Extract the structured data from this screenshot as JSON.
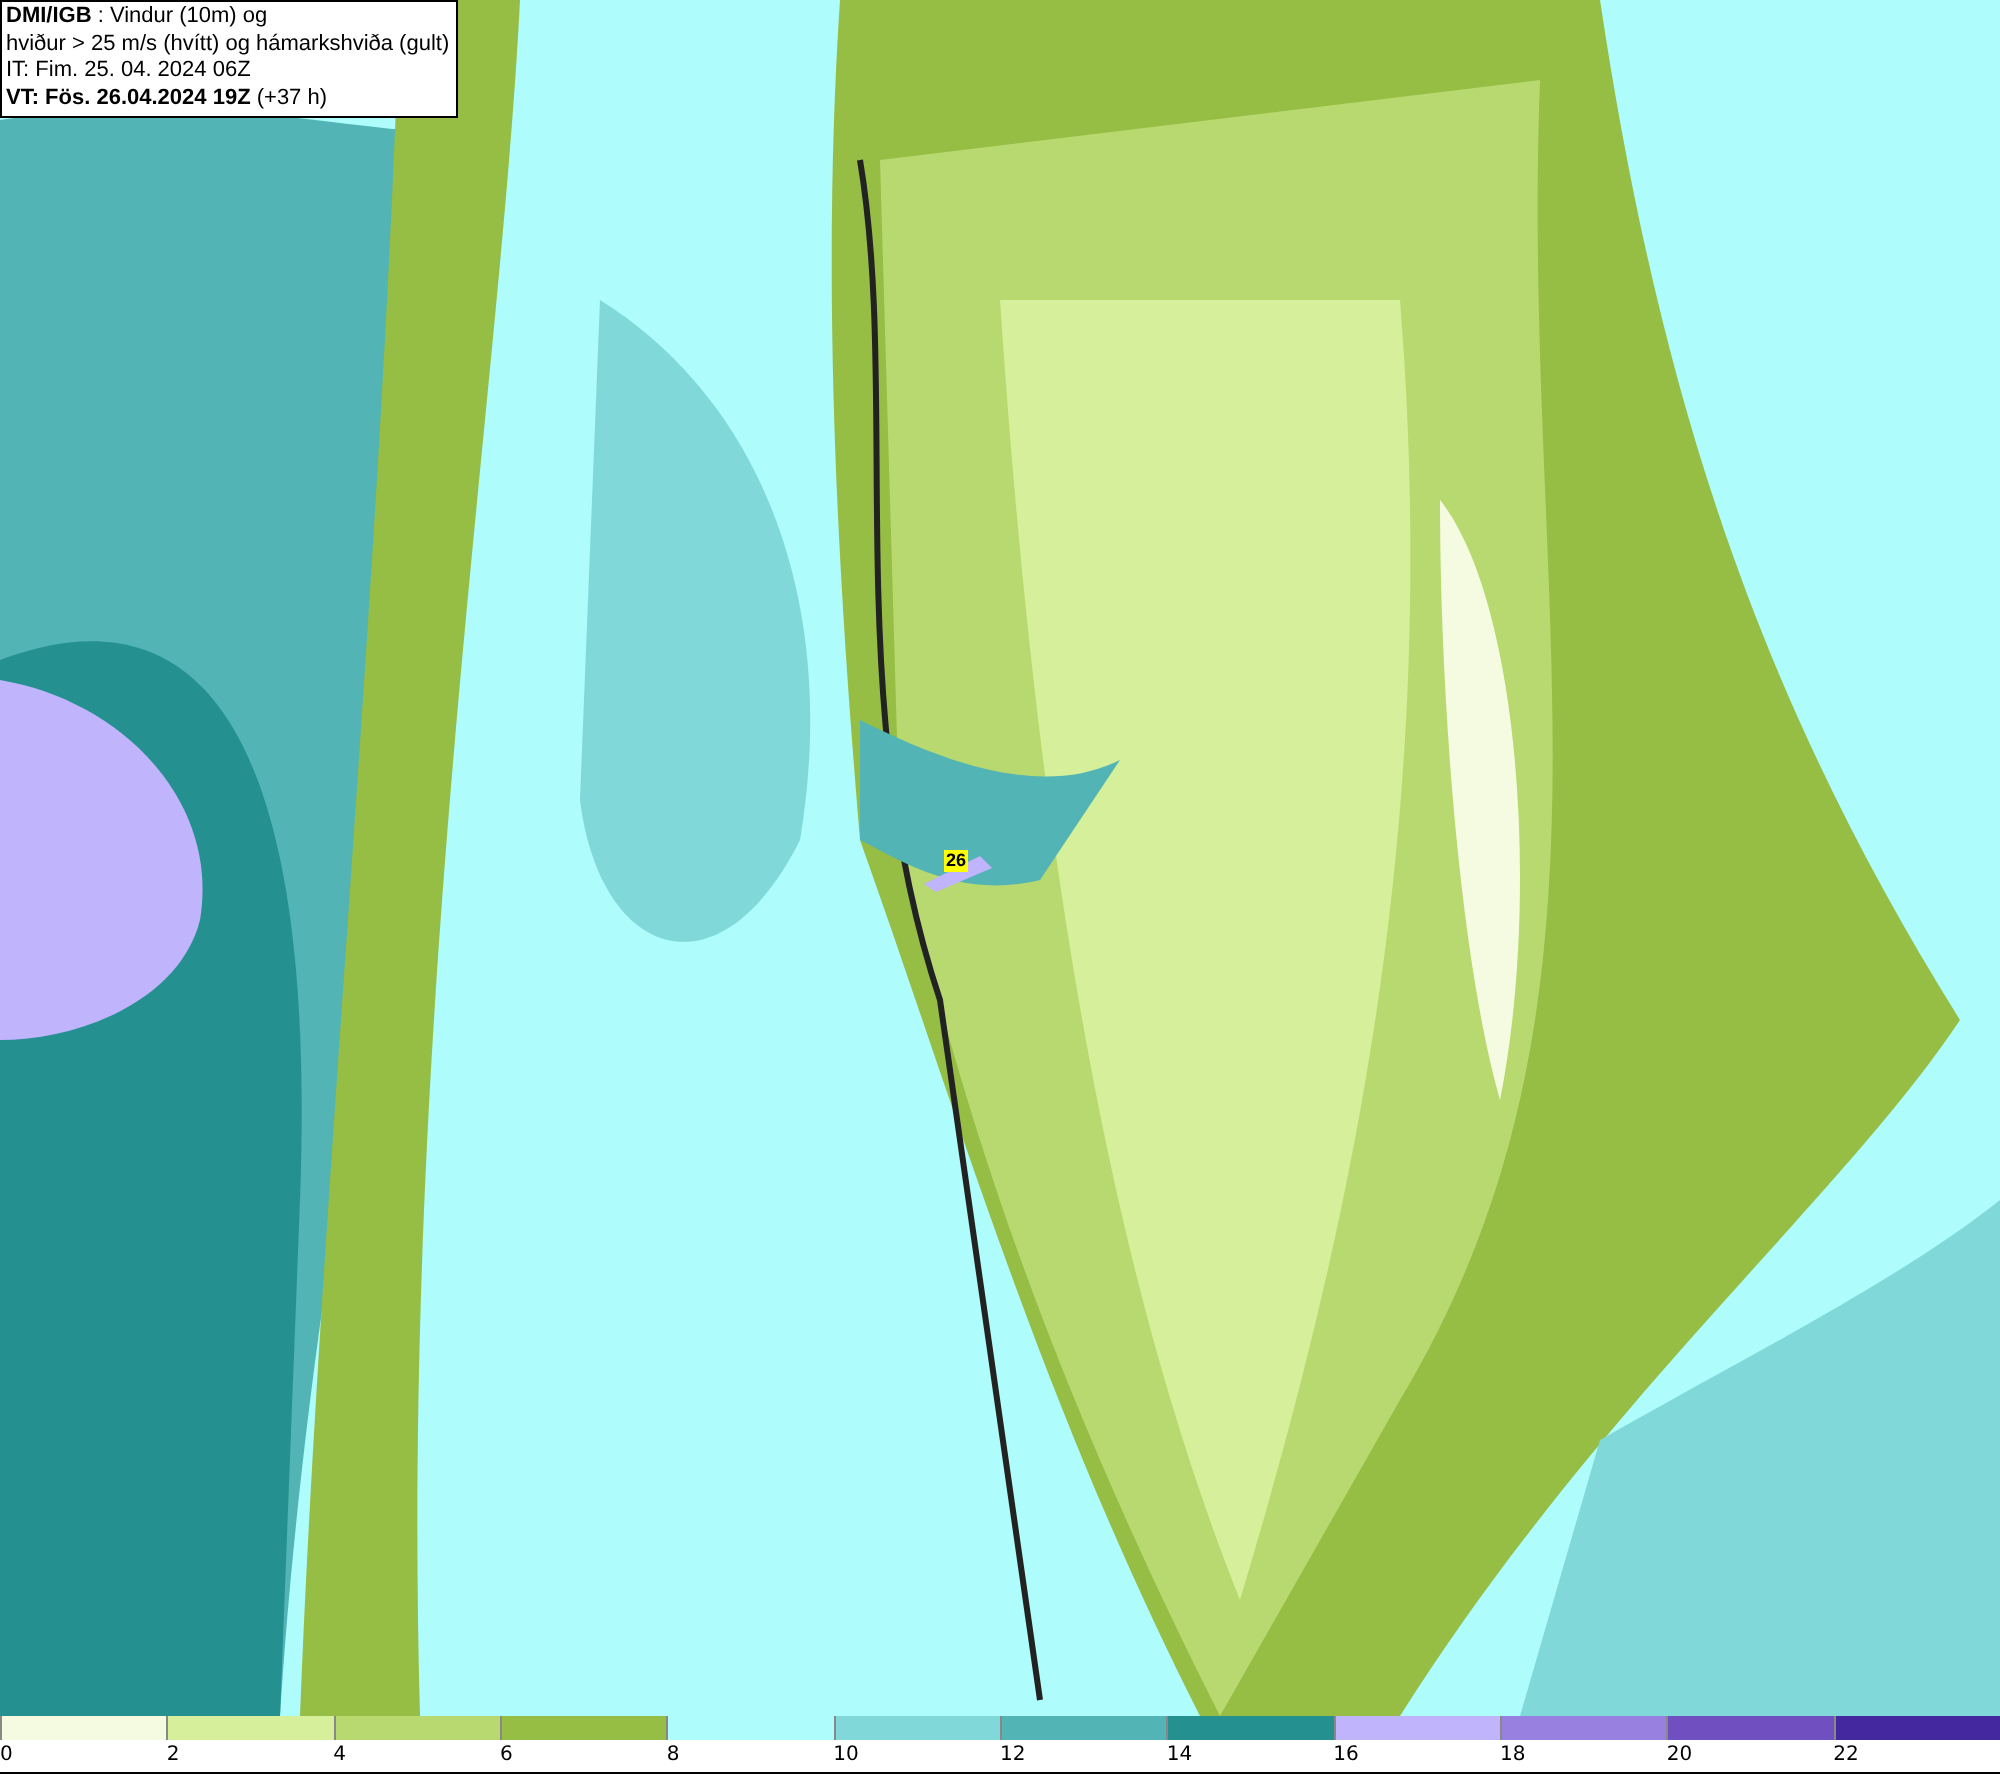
{
  "title_box": {
    "lines": [
      "**DMI/IGB** : Vindur (10m) og",
      "hviður > 25 m/s (hvítt) og hámarkshviða (gult)",
      "IT: Fim. 25. 04. 2024 06Z",
      "**VT: Fös. 26.04.2024 19Z** (+37 h)"
    ]
  },
  "map": {
    "gust_labels": [
      {
        "value": "26"
      }
    ]
  },
  "legend": {
    "bins": [
      {
        "label": "0",
        "color": "#f5fbe0"
      },
      {
        "label": "2",
        "color": "#d6ef9a"
      },
      {
        "label": "4",
        "color": "#b7d96f"
      },
      {
        "label": "6",
        "color": "#96bd44"
      },
      {
        "label": "8",
        "color": "#aefcfc"
      },
      {
        "label": "10",
        "color": "#80d8d8"
      },
      {
        "label": "12",
        "color": "#52b4b4"
      },
      {
        "label": "14",
        "color": "#259090"
      },
      {
        "label": "16",
        "color": "#c0b4fc"
      },
      {
        "label": "18",
        "color": "#9880e0"
      },
      {
        "label": "20",
        "color": "#7050c0"
      },
      {
        "label": "22",
        "color": "#4428a0"
      }
    ]
  }
}
